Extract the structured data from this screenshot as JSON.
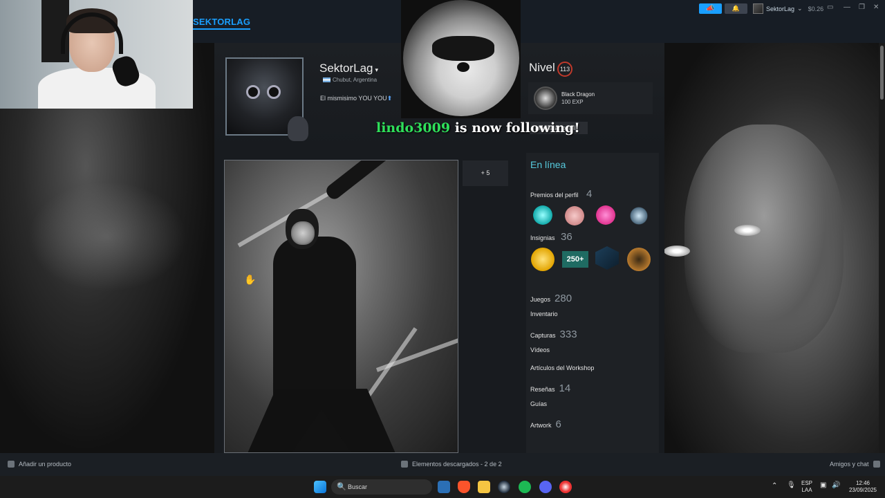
{
  "topbar": {
    "username": "SEKTORLAG",
    "account_name": "SektorLag",
    "account_caret": "⌄",
    "balance": "$0.26",
    "announce_icon": "megaphone-icon",
    "bell_icon": "bell-icon"
  },
  "profile": {
    "persona_name": "SektorLag",
    "caret": "▾",
    "location": "Chubut, Argentina",
    "summary": "El mismisimo YOU YOU",
    "summary_arrow": "⬆",
    "level_label": "Nivel",
    "level": "113",
    "badge_name": "Black Dragon",
    "badge_xp": "100 EXP",
    "edit_button": "Modificar perfil"
  },
  "overlay": {
    "follower": "lindo3009",
    "follow_text": " is now following!"
  },
  "showcase": {
    "more_label": "+ 5"
  },
  "sidebar": {
    "status": "En línea",
    "awards_label": "Premios del perfil",
    "awards_count": "4",
    "badges_label": "Insignias",
    "badges_count": "36",
    "badge_250": "250+",
    "stats": [
      {
        "label": "Juegos",
        "count": "280"
      },
      {
        "label": "Inventario",
        "count": ""
      },
      {
        "label": "Capturas",
        "count": "333"
      },
      {
        "label": "Vídeos",
        "count": ""
      },
      {
        "label": "Artículos del Workshop",
        "count": ""
      },
      {
        "label": "Reseñas",
        "count": "14"
      },
      {
        "label": "Guías",
        "count": ""
      },
      {
        "label": "Artwork",
        "count": "6"
      }
    ]
  },
  "steambar": {
    "add_product": "Añadir un producto",
    "downloads": "Elementos descargados - 2 de 2",
    "friends": "Amigos y chat"
  },
  "taskbar": {
    "search_placeholder": "Buscar",
    "lang_top": "ESP",
    "lang_bottom": "LAA",
    "time": "12:46",
    "date": "23/09/2025"
  },
  "colors": {
    "accent": "#1a9fff",
    "online": "#57cbde",
    "follower": "#2fe05a",
    "level_ring": "#c0392b"
  }
}
